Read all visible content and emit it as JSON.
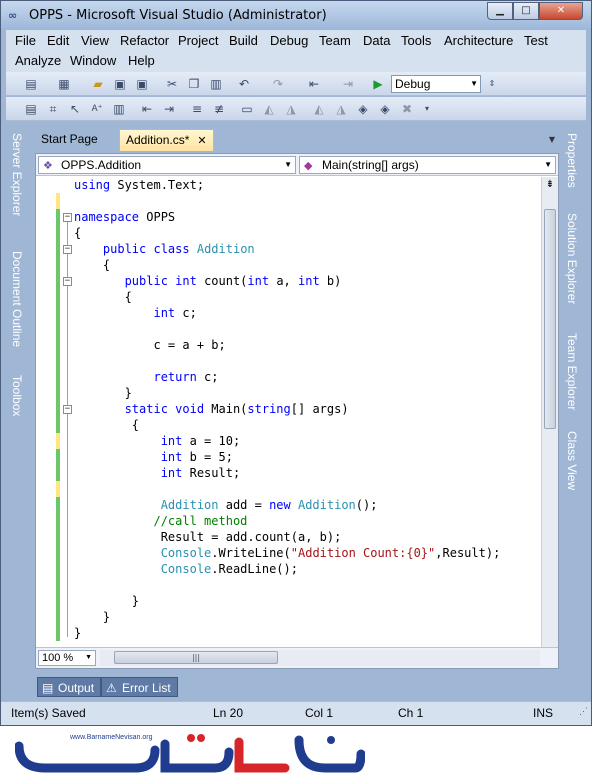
{
  "window": {
    "title": "OPPS - Microsoft Visual Studio (Administrator)",
    "controls": [
      "minimize",
      "maximize",
      "close"
    ]
  },
  "menu": {
    "row1": [
      "File",
      "Edit",
      "View",
      "Refactor",
      "Project",
      "Build",
      "Debug",
      "Team",
      "Data",
      "Tools",
      "Architecture",
      "Test"
    ],
    "row2": [
      "Analyze",
      "Window",
      "Help"
    ]
  },
  "toolbar": {
    "configuration": "Debug",
    "icons_row1": [
      "new-project-icon",
      "add-item-icon",
      "open-file-icon",
      "save-icon",
      "save-all-icon",
      "cut-icon",
      "copy-icon",
      "paste-icon",
      "undo-icon",
      "redo-icon",
      "navigate-backward-icon",
      "navigate-forward-icon",
      "start-debugging-icon"
    ],
    "icons_row2": [
      "text-editor-icons"
    ]
  },
  "left_dock": [
    "Server Explorer",
    "Document Outline",
    "Toolbox"
  ],
  "right_dock": [
    "Properties",
    "Solution Explorer",
    "Team Explorer",
    "Class View"
  ],
  "tabs": [
    {
      "label": "Start Page",
      "active": false
    },
    {
      "label": "Addition.cs*",
      "active": true,
      "close": "✕"
    }
  ],
  "navigation": {
    "type_combo": "OPPS.Addition",
    "member_combo": "Main(string[] args)"
  },
  "code_lines": [
    [
      {
        "t": "using ",
        "c": "kw"
      },
      {
        "t": "System.Text;",
        "c": ""
      }
    ],
    [],
    [
      {
        "t": "namespace ",
        "c": "kw"
      },
      {
        "t": "OPPS",
        "c": ""
      }
    ],
    [
      {
        "t": "{",
        "c": ""
      }
    ],
    [
      {
        "t": "    public ",
        "c": "kw"
      },
      {
        "t": "class ",
        "c": "kw"
      },
      {
        "t": "Addition",
        "c": "ty"
      }
    ],
    [
      {
        "t": "    {",
        "c": ""
      }
    ],
    [
      {
        "t": "       public ",
        "c": "kw"
      },
      {
        "t": "int ",
        "c": "kw"
      },
      {
        "t": "count(",
        "c": ""
      },
      {
        "t": "int ",
        "c": "kw"
      },
      {
        "t": "a, ",
        "c": ""
      },
      {
        "t": "int ",
        "c": "kw"
      },
      {
        "t": "b)",
        "c": ""
      }
    ],
    [
      {
        "t": "       {",
        "c": ""
      }
    ],
    [
      {
        "t": "           int ",
        "c": "kw"
      },
      {
        "t": "c;",
        "c": ""
      }
    ],
    [],
    [
      {
        "t": "           c = a + b;",
        "c": ""
      }
    ],
    [],
    [
      {
        "t": "           return ",
        "c": "kw"
      },
      {
        "t": "c;",
        "c": ""
      }
    ],
    [
      {
        "t": "       }",
        "c": ""
      }
    ],
    [
      {
        "t": "       static ",
        "c": "kw"
      },
      {
        "t": "void ",
        "c": "kw"
      },
      {
        "t": "Main(",
        "c": ""
      },
      {
        "t": "string",
        "c": "kw"
      },
      {
        "t": "[] args)",
        "c": ""
      }
    ],
    [
      {
        "t": "        {",
        "c": ""
      }
    ],
    [
      {
        "t": "            int ",
        "c": "kw"
      },
      {
        "t": "a = 10;",
        "c": ""
      }
    ],
    [
      {
        "t": "            int ",
        "c": "kw"
      },
      {
        "t": "b = 5;",
        "c": ""
      }
    ],
    [
      {
        "t": "            int ",
        "c": "kw"
      },
      {
        "t": "Result;",
        "c": ""
      }
    ],
    [],
    [
      {
        "t": "            Addition ",
        "c": "ty"
      },
      {
        "t": "add = ",
        "c": ""
      },
      {
        "t": "new ",
        "c": "kw"
      },
      {
        "t": "Addition",
        "c": "ty"
      },
      {
        "t": "();",
        "c": ""
      }
    ],
    [
      {
        "t": "           //call method",
        "c": "cm"
      }
    ],
    [
      {
        "t": "            Result = add.count(a, b);",
        "c": ""
      }
    ],
    [
      {
        "t": "            Console",
        "c": "ty"
      },
      {
        "t": ".WriteLine(",
        "c": ""
      },
      {
        "t": "\"Addition Count:{0}\"",
        "c": "str"
      },
      {
        "t": ",Result);",
        "c": ""
      }
    ],
    [
      {
        "t": "            Console",
        "c": "ty"
      },
      {
        "t": ".ReadLine();",
        "c": ""
      }
    ],
    [],
    [
      {
        "t": "        }",
        "c": ""
      }
    ],
    [
      {
        "t": "    }",
        "c": ""
      }
    ],
    [
      {
        "t": "}",
        "c": ""
      }
    ]
  ],
  "zoom": "100 %",
  "bottom_tabs": [
    "Output",
    "Error List"
  ],
  "status": {
    "message": "Item(s) Saved",
    "line": "Ln 20",
    "col": "Col 1",
    "ch": "Ch 1",
    "mode": "INS"
  },
  "watermark": {
    "url": "www.BarnameNevisan.org",
    "colors": {
      "blue": "#1f3c8f",
      "red": "#d6262a"
    }
  },
  "colors": {
    "keyword": "#0000ff",
    "type": "#2b91af",
    "string": "#a31515",
    "comment": "#008000",
    "chrome": "#9fb6d4"
  }
}
